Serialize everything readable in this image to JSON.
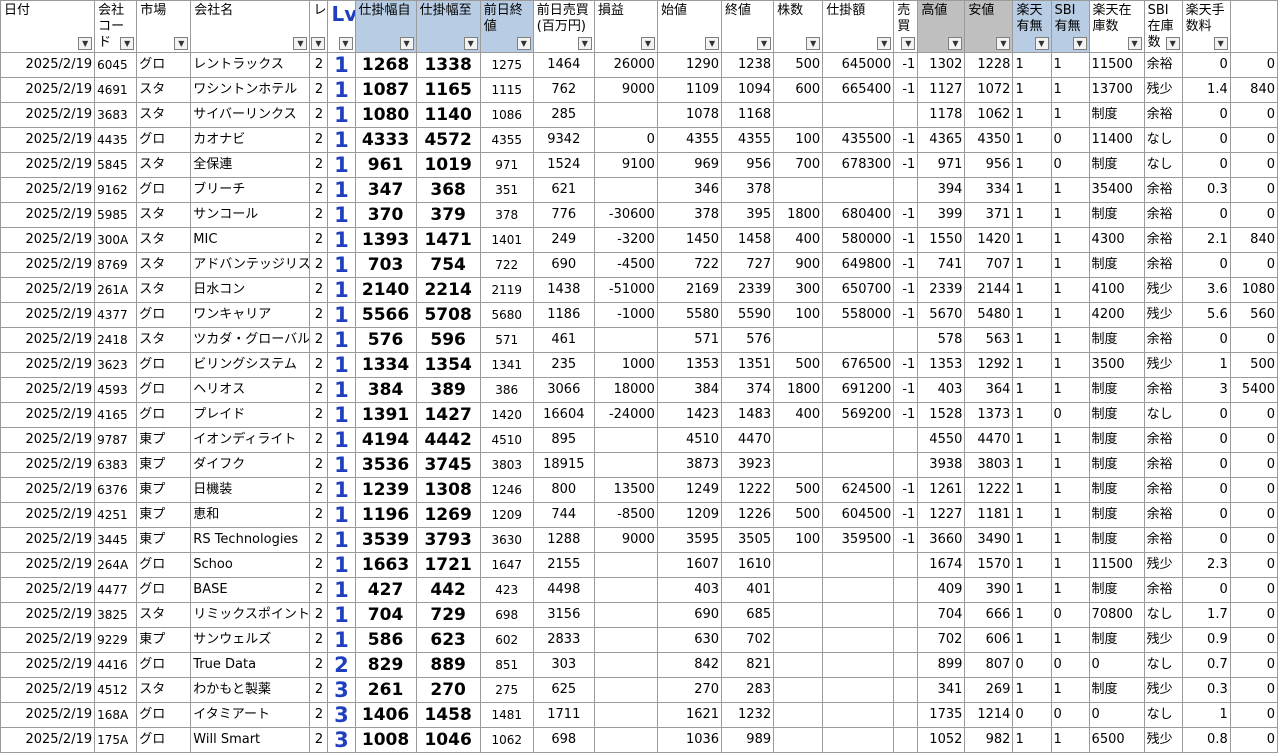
{
  "headers": [
    {
      "label": "日付",
      "style": ""
    },
    {
      "label": "会社コード",
      "style": ""
    },
    {
      "label": "市場",
      "style": ""
    },
    {
      "label": "会社名",
      "style": ""
    },
    {
      "label": "レ",
      "style": ""
    },
    {
      "label": "Lv",
      "style": "lv"
    },
    {
      "label": "仕掛幅自",
      "style": "blue"
    },
    {
      "label": "仕掛幅至",
      "style": "blue"
    },
    {
      "label": "前日終値",
      "style": "blue"
    },
    {
      "label": "前日売買(百万円)",
      "style": ""
    },
    {
      "label": "損益",
      "style": ""
    },
    {
      "label": "始値",
      "style": ""
    },
    {
      "label": "終値",
      "style": ""
    },
    {
      "label": "株数",
      "style": ""
    },
    {
      "label": "仕掛額",
      "style": ""
    },
    {
      "label": "売買",
      "style": ""
    },
    {
      "label": "高値",
      "style": "gray"
    },
    {
      "label": "安値",
      "style": "gray"
    },
    {
      "label": "楽天有無",
      "style": "blue"
    },
    {
      "label": "SBI有無",
      "style": "blue"
    },
    {
      "label": "楽天在庫数",
      "style": ""
    },
    {
      "label": "SBI在庫数",
      "style": ""
    },
    {
      "label": "楽天手数料",
      "style": ""
    },
    {
      "label": "",
      "style": ""
    }
  ],
  "rows": [
    [
      "2025/2/19",
      "6045",
      "グロ",
      "レントラックス",
      "2",
      "1",
      "1268",
      "1338",
      "1275",
      "1464",
      "26000",
      "1290",
      "1238",
      "500",
      "645000",
      "-1",
      "1302",
      "1228",
      "1",
      "1",
      "11500",
      "余裕",
      "0",
      "0"
    ],
    [
      "2025/2/19",
      "4691",
      "スタ",
      "ワシントンホテル",
      "2",
      "1",
      "1087",
      "1165",
      "1115",
      "762",
      "9000",
      "1109",
      "1094",
      "600",
      "665400",
      "-1",
      "1127",
      "1072",
      "1",
      "1",
      "13700",
      "残少",
      "1.4",
      "840"
    ],
    [
      "2025/2/19",
      "3683",
      "スタ",
      "サイバーリンクス",
      "2",
      "1",
      "1080",
      "1140",
      "1086",
      "285",
      "",
      "1078",
      "1168",
      "",
      "",
      "",
      "1178",
      "1062",
      "1",
      "1",
      "制度",
      "余裕",
      "0",
      "0"
    ],
    [
      "2025/2/19",
      "4435",
      "グロ",
      "カオナビ",
      "2",
      "1",
      "4333",
      "4572",
      "4355",
      "9342",
      "0",
      "4355",
      "4355",
      "100",
      "435500",
      "-1",
      "4365",
      "4350",
      "1",
      "0",
      "11400",
      "なし",
      "0",
      "0"
    ],
    [
      "2025/2/19",
      "5845",
      "スタ",
      "全保連",
      "2",
      "1",
      "961",
      "1019",
      "971",
      "1524",
      "9100",
      "969",
      "956",
      "700",
      "678300",
      "-1",
      "971",
      "956",
      "1",
      "0",
      "制度",
      "なし",
      "0",
      "0"
    ],
    [
      "2025/2/19",
      "9162",
      "グロ",
      "ブリーチ",
      "2",
      "1",
      "347",
      "368",
      "351",
      "621",
      "",
      "346",
      "378",
      "",
      "",
      "",
      "394",
      "334",
      "1",
      "1",
      "35400",
      "余裕",
      "0.3",
      "0"
    ],
    [
      "2025/2/19",
      "5985",
      "スタ",
      "サンコール",
      "2",
      "1",
      "370",
      "379",
      "378",
      "776",
      "-30600",
      "378",
      "395",
      "1800",
      "680400",
      "-1",
      "399",
      "371",
      "1",
      "1",
      "制度",
      "余裕",
      "0",
      "0"
    ],
    [
      "2025/2/19",
      "300A",
      "スタ",
      "MIC",
      "2",
      "1",
      "1393",
      "1471",
      "1401",
      "249",
      "-3200",
      "1450",
      "1458",
      "400",
      "580000",
      "-1",
      "1550",
      "1420",
      "1",
      "1",
      "4300",
      "余裕",
      "2.1",
      "840"
    ],
    [
      "2025/2/19",
      "8769",
      "スタ",
      "アドバンテッジリスク",
      "2",
      "1",
      "703",
      "754",
      "722",
      "690",
      "-4500",
      "722",
      "727",
      "900",
      "649800",
      "-1",
      "741",
      "707",
      "1",
      "1",
      "制度",
      "余裕",
      "0",
      "0"
    ],
    [
      "2025/2/19",
      "261A",
      "スタ",
      "日水コン",
      "2",
      "1",
      "2140",
      "2214",
      "2119",
      "1438",
      "-51000",
      "2169",
      "2339",
      "300",
      "650700",
      "-1",
      "2339",
      "2144",
      "1",
      "1",
      "4100",
      "残少",
      "3.6",
      "1080"
    ],
    [
      "2025/2/19",
      "4377",
      "グロ",
      "ワンキャリア",
      "2",
      "1",
      "5566",
      "5708",
      "5680",
      "1186",
      "-1000",
      "5580",
      "5590",
      "100",
      "558000",
      "-1",
      "5670",
      "5480",
      "1",
      "1",
      "4200",
      "残少",
      "5.6",
      "560"
    ],
    [
      "2025/2/19",
      "2418",
      "スタ",
      "ツカダ・グローバル",
      "2",
      "1",
      "576",
      "596",
      "571",
      "461",
      "",
      "571",
      "576",
      "",
      "",
      "",
      "578",
      "563",
      "1",
      "1",
      "制度",
      "余裕",
      "0",
      "0"
    ],
    [
      "2025/2/19",
      "3623",
      "グロ",
      "ビリングシステム",
      "2",
      "1",
      "1334",
      "1354",
      "1341",
      "235",
      "1000",
      "1353",
      "1351",
      "500",
      "676500",
      "-1",
      "1353",
      "1292",
      "1",
      "1",
      "3500",
      "残少",
      "1",
      "500"
    ],
    [
      "2025/2/19",
      "4593",
      "グロ",
      "ヘリオス",
      "2",
      "1",
      "384",
      "389",
      "386",
      "3066",
      "18000",
      "384",
      "374",
      "1800",
      "691200",
      "-1",
      "403",
      "364",
      "1",
      "1",
      "制度",
      "余裕",
      "3",
      "5400"
    ],
    [
      "2025/2/19",
      "4165",
      "グロ",
      "プレイド",
      "2",
      "1",
      "1391",
      "1427",
      "1420",
      "16604",
      "-24000",
      "1423",
      "1483",
      "400",
      "569200",
      "-1",
      "1528",
      "1373",
      "1",
      "0",
      "制度",
      "なし",
      "0",
      "0"
    ],
    [
      "2025/2/19",
      "9787",
      "東プ",
      "イオンディライト",
      "2",
      "1",
      "4194",
      "4442",
      "4510",
      "895",
      "",
      "4510",
      "4470",
      "",
      "",
      "",
      "4550",
      "4470",
      "1",
      "1",
      "制度",
      "余裕",
      "0",
      "0"
    ],
    [
      "2025/2/19",
      "6383",
      "東プ",
      "ダイフク",
      "2",
      "1",
      "3536",
      "3745",
      "3803",
      "18915",
      "",
      "3873",
      "3923",
      "",
      "",
      "",
      "3938",
      "3803",
      "1",
      "1",
      "制度",
      "余裕",
      "0",
      "0"
    ],
    [
      "2025/2/19",
      "6376",
      "東プ",
      "日機装",
      "2",
      "1",
      "1239",
      "1308",
      "1246",
      "800",
      "13500",
      "1249",
      "1222",
      "500",
      "624500",
      "-1",
      "1261",
      "1222",
      "1",
      "1",
      "制度",
      "余裕",
      "0",
      "0"
    ],
    [
      "2025/2/19",
      "4251",
      "東プ",
      "恵和",
      "2",
      "1",
      "1196",
      "1269",
      "1209",
      "744",
      "-8500",
      "1209",
      "1226",
      "500",
      "604500",
      "-1",
      "1227",
      "1181",
      "1",
      "1",
      "制度",
      "余裕",
      "0",
      "0"
    ],
    [
      "2025/2/19",
      "3445",
      "東プ",
      "RS Technologies",
      "2",
      "1",
      "3539",
      "3793",
      "3630",
      "1288",
      "9000",
      "3595",
      "3505",
      "100",
      "359500",
      "-1",
      "3660",
      "3490",
      "1",
      "1",
      "制度",
      "余裕",
      "0",
      "0"
    ],
    [
      "2025/2/19",
      "264A",
      "グロ",
      "Schoo",
      "2",
      "1",
      "1663",
      "1721",
      "1647",
      "2155",
      "",
      "1607",
      "1610",
      "",
      "",
      "",
      "1674",
      "1570",
      "1",
      "1",
      "11500",
      "残少",
      "2.3",
      "0"
    ],
    [
      "2025/2/19",
      "4477",
      "グロ",
      "BASE",
      "2",
      "1",
      "427",
      "442",
      "423",
      "4498",
      "",
      "403",
      "401",
      "",
      "",
      "",
      "409",
      "390",
      "1",
      "1",
      "制度",
      "余裕",
      "0",
      "0"
    ],
    [
      "2025/2/19",
      "3825",
      "スタ",
      "リミックスポイント",
      "2",
      "1",
      "704",
      "729",
      "698",
      "3156",
      "",
      "690",
      "685",
      "",
      "",
      "",
      "704",
      "666",
      "1",
      "0",
      "70800",
      "なし",
      "1.7",
      "0"
    ],
    [
      "2025/2/19",
      "9229",
      "東プ",
      "サンウェルズ",
      "2",
      "1",
      "586",
      "623",
      "602",
      "2833",
      "",
      "630",
      "702",
      "",
      "",
      "",
      "702",
      "606",
      "1",
      "1",
      "制度",
      "残少",
      "0.9",
      "0"
    ],
    [
      "2025/2/19",
      "4416",
      "グロ",
      "True Data",
      "2",
      "2",
      "829",
      "889",
      "851",
      "303",
      "",
      "842",
      "821",
      "",
      "",
      "",
      "899",
      "807",
      "0",
      "0",
      "0",
      "なし",
      "0.7",
      "0"
    ],
    [
      "2025/2/19",
      "4512",
      "スタ",
      "わかもと製薬",
      "2",
      "3",
      "261",
      "270",
      "275",
      "625",
      "",
      "270",
      "283",
      "",
      "",
      "",
      "341",
      "269",
      "1",
      "1",
      "制度",
      "残少",
      "0.3",
      "0"
    ],
    [
      "2025/2/19",
      "168A",
      "グロ",
      "イタミアート",
      "2",
      "3",
      "1406",
      "1458",
      "1481",
      "1711",
      "",
      "1621",
      "1232",
      "",
      "",
      "",
      "1735",
      "1214",
      "0",
      "0",
      "0",
      "なし",
      "1",
      "0"
    ],
    [
      "2025/2/19",
      "175A",
      "グロ",
      "Will Smart",
      "2",
      "3",
      "1008",
      "1046",
      "1062",
      "698",
      "",
      "1036",
      "989",
      "",
      "",
      "",
      "1052",
      "982",
      "1",
      "1",
      "6500",
      "残少",
      "0.8",
      "0"
    ]
  ]
}
